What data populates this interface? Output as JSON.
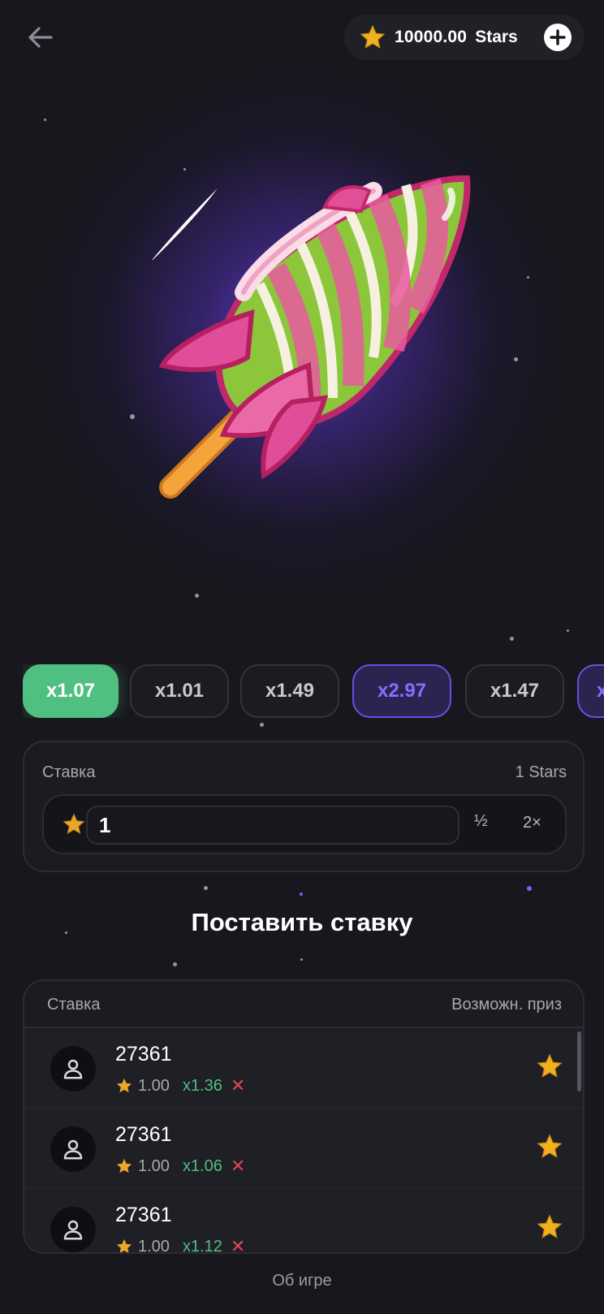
{
  "header": {
    "back_icon": "arrow-left-icon",
    "balance_amount": "10000.00",
    "balance_unit": "Stars",
    "add_icon": "plus-circle-icon"
  },
  "multipliers": [
    {
      "label": "x1.07",
      "style": "green"
    },
    {
      "label": "x1.01",
      "style": "default"
    },
    {
      "label": "x1.49",
      "style": "default"
    },
    {
      "label": "x2.97",
      "style": "purple"
    },
    {
      "label": "x1.47",
      "style": "default"
    },
    {
      "label": "x",
      "style": "purple"
    }
  ],
  "bet": {
    "label": "Ставка",
    "stars_text": "1 Stars",
    "value": "1",
    "half_label": "½",
    "double_label": "2×"
  },
  "place_bet_label": "Поставить ставку",
  "bets_table": {
    "col_bet": "Ставка",
    "col_prize": "Возможн. приз",
    "rows": [
      {
        "user": "27361",
        "amount": "1.00",
        "multiplier": "x1.36",
        "status": "✕"
      },
      {
        "user": "27361",
        "amount": "1.00",
        "multiplier": "x1.06",
        "status": "✕"
      },
      {
        "user": "27361",
        "amount": "1.00",
        "multiplier": "x1.12",
        "status": "✕"
      }
    ]
  },
  "footer_link": "Об игре",
  "colors": {
    "background": "#17171d",
    "accent_green": "#4fbf82",
    "accent_purple": "#8a6cff",
    "lose_red": "#e0474c",
    "star_gold": "#f2b01e"
  }
}
